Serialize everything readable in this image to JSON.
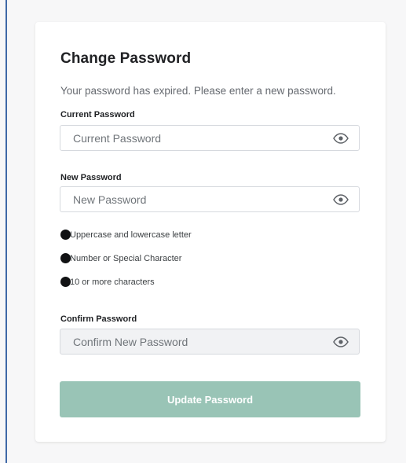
{
  "form": {
    "title": "Change Password",
    "subtitle": "Your password has expired. Please enter a new password.",
    "current": {
      "label": "Current Password",
      "placeholder": "Current Password",
      "value": ""
    },
    "new": {
      "label": "New Password",
      "placeholder": "New Password",
      "value": ""
    },
    "requirements": [
      {
        "text": "Uppercase and lowercase letter"
      },
      {
        "text": "Number or Special Character"
      },
      {
        "text": "10 or more characters"
      }
    ],
    "confirm": {
      "label": "Confirm Password",
      "placeholder": "Confirm New Password",
      "value": ""
    },
    "submit_label": "Update Password"
  },
  "icons": {
    "eye": "eye-icon",
    "requirement_dot": "bullet-dot-icon"
  },
  "colors": {
    "button": "#99c4b6",
    "card": "#ffffff",
    "background": "#f7f7f8",
    "frame_border": "#3f68a7"
  }
}
